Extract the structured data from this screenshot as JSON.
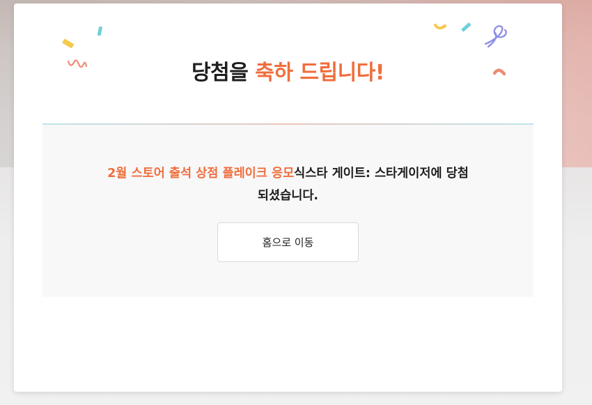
{
  "modal": {
    "title_prefix": "당첨을 ",
    "title_highlight": "축하 드립니다!",
    "message_highlight": "2월 스토어 출석 상점 플레이크 응모",
    "message_rest": "식스타 게이트: 스타게이저에 당첨",
    "message_line2": "되셨습니다.",
    "home_button_label": "홈으로 이동"
  },
  "colors": {
    "accent": "#ef6e3c",
    "text": "#1d1d1d",
    "panel_bg": "#f8f8f9",
    "confetti_yellow": "#f5c84c",
    "confetti_teal": "#6fd0dc",
    "confetti_coral": "#ee8b73",
    "confetti_purple": "#8e8ee8"
  }
}
